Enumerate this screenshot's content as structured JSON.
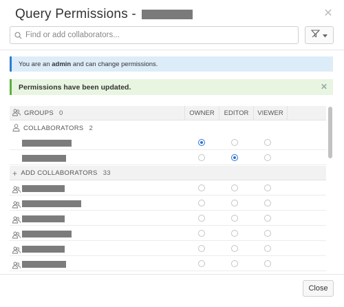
{
  "dialog": {
    "title": "Query Permissions -",
    "close_icon": "close-icon"
  },
  "search": {
    "placeholder": "Find or add collaborators...",
    "value": ""
  },
  "filter": {
    "icon": "filter-icon"
  },
  "alerts": {
    "info_prefix": "You are an ",
    "info_role": "admin",
    "info_suffix": " and can change permissions.",
    "success": "Permissions have been updated."
  },
  "table": {
    "groups_label": "GROUPS",
    "groups_count": "0",
    "columns": [
      "OWNER",
      "EDITOR",
      "VIEWER"
    ],
    "collaborators_label": "COLLABORATORS",
    "collaborators_count": "2",
    "add_label": "ADD COLLABORATORS",
    "add_count": "33",
    "collaborators": [
      {
        "role": "owner"
      },
      {
        "role": "editor"
      }
    ]
  },
  "footer": {
    "close_label": "Close"
  },
  "colors": {
    "accent": "#2b74d4",
    "info_bg": "#dcecf9",
    "success_bg": "#e8f5e0"
  }
}
